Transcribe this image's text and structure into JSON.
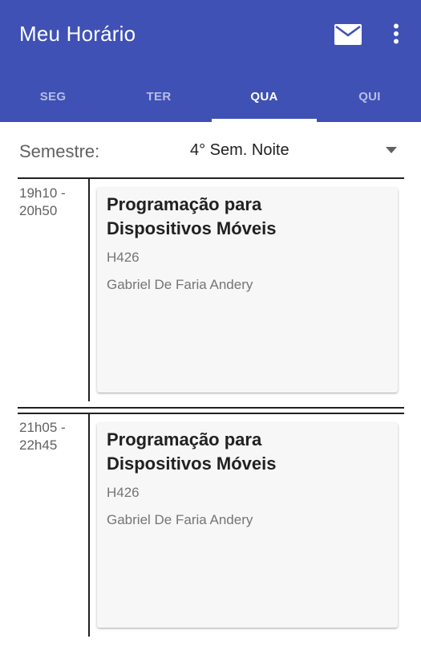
{
  "app": {
    "title": "Meu Horário"
  },
  "toolbar": {
    "mail_icon": "mail-icon",
    "more_icon": "more-vert-icon"
  },
  "tabs": [
    {
      "label": "SEG",
      "active": false
    },
    {
      "label": "TER",
      "active": false
    },
    {
      "label": "QUA",
      "active": true
    },
    {
      "label": "QUI",
      "active": false
    }
  ],
  "semester": {
    "label": "Semestre:",
    "value": "4° Sem. Noite"
  },
  "classes": [
    {
      "time_start": "19h10 -",
      "time_end": "20h50",
      "title_line1": "Programação para",
      "title_line2": "Dispositivos Móveis",
      "room": "H426",
      "teacher": "Gabriel De Faria Andery"
    },
    {
      "time_start": "21h05 -",
      "time_end": "22h45",
      "title_line1": "Programação para",
      "title_line2": "Dispositivos Móveis",
      "room": "H426",
      "teacher": "Gabriel De Faria Andery"
    }
  ],
  "colors": {
    "primary": "#3f51b5",
    "accent_text": "#ffffff",
    "card_bg": "#f7f7f7"
  }
}
